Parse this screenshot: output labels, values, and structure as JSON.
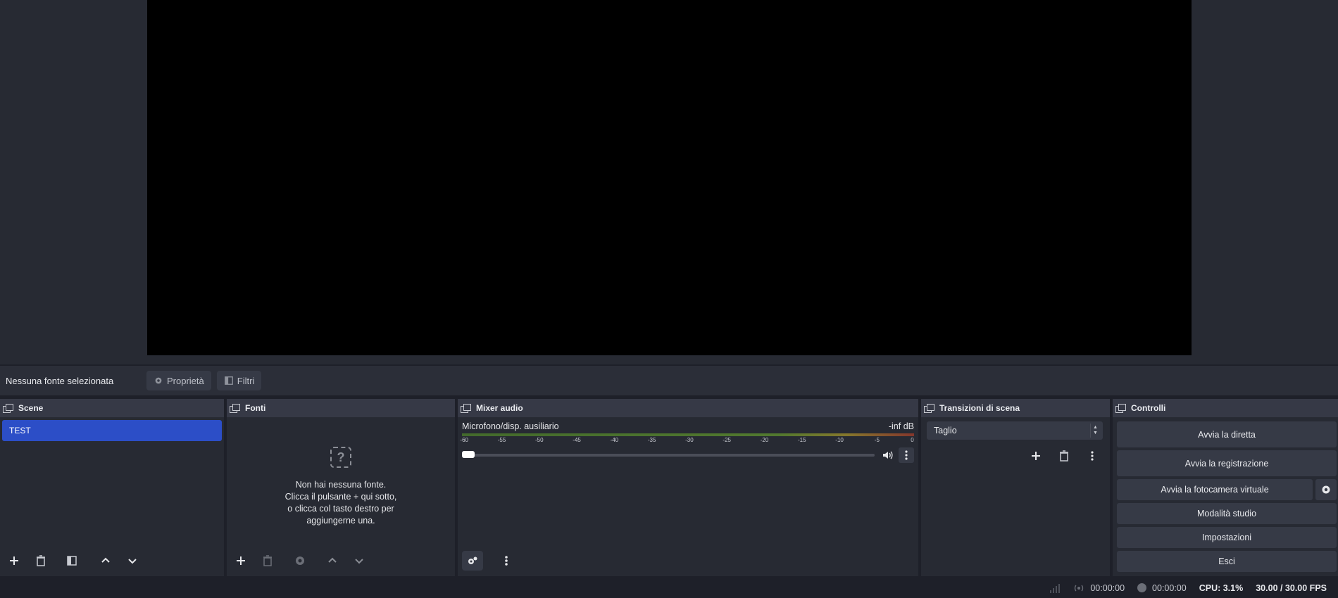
{
  "context_bar": {
    "no_source_label": "Nessuna fonte selezionata",
    "properties_label": "Proprietà",
    "filters_label": "Filtri"
  },
  "scenes": {
    "title": "Scene",
    "items": [
      {
        "label": "TEST",
        "selected": true
      }
    ]
  },
  "sources": {
    "title": "Fonti",
    "empty_lines": [
      "Non hai nessuna fonte.",
      "Clicca il pulsante + qui sotto,",
      "o clicca col tasto destro per",
      "aggiungerne una."
    ]
  },
  "mixer": {
    "title": "Mixer audio",
    "channel_name": "Microfono/disp. ausiliario",
    "level": "-inf dB",
    "ticks": [
      "-60",
      "-55",
      "-50",
      "-45",
      "-40",
      "-35",
      "-30",
      "-25",
      "-20",
      "-15",
      "-10",
      "-5",
      "0"
    ]
  },
  "transitions": {
    "title": "Transizioni di scena",
    "selected": "Taglio"
  },
  "controls": {
    "title": "Controlli",
    "start_stream": "Avvia la diretta",
    "start_recording": "Avvia la registrazione",
    "start_virtual_cam": "Avvia la fotocamera virtuale",
    "studio_mode": "Modalità studio",
    "settings": "Impostazioni",
    "exit": "Esci"
  },
  "status": {
    "stream_time": "00:00:00",
    "record_time": "00:00:00",
    "cpu": "CPU: 3.1%",
    "fps": "30.00 / 30.00 FPS"
  },
  "colors": {
    "accent": "#2c4ec7",
    "background": "#272a33",
    "panel_header": "#363946"
  }
}
